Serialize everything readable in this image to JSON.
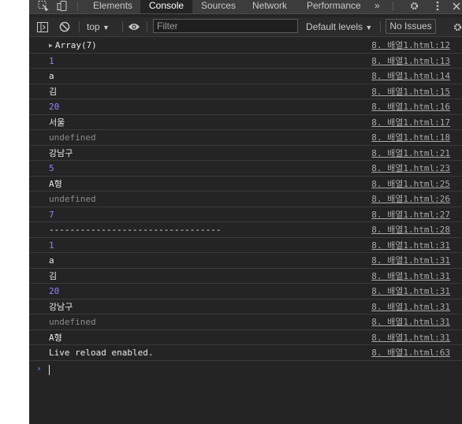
{
  "tabs": [
    {
      "label": "Elements",
      "active": false
    },
    {
      "label": "Console",
      "active": true
    },
    {
      "label": "Sources",
      "active": false
    },
    {
      "label": "Network",
      "active": false
    },
    {
      "label": "Performance",
      "active": false
    }
  ],
  "tabs_overflow": "»",
  "toolbar": {
    "context": "top",
    "filter_placeholder": "Filter",
    "levels": "Default levels",
    "issues": "No Issues"
  },
  "messages": [
    {
      "text": "Array(7)",
      "type": "obj",
      "source": "8. 배열1.html:12",
      "expandable": true
    },
    {
      "text": "1",
      "type": "num",
      "source": "8. 배열1.html:13"
    },
    {
      "text": "a",
      "type": "str",
      "source": "8. 배열1.html:14"
    },
    {
      "text": "김",
      "type": "str",
      "source": "8. 배열1.html:15"
    },
    {
      "text": "20",
      "type": "num",
      "source": "8. 배열1.html:16"
    },
    {
      "text": "서울",
      "type": "str",
      "source": "8. 배열1.html:17"
    },
    {
      "text": "undefined",
      "type": "undef",
      "source": "8. 배열1.html:18"
    },
    {
      "text": "강남구",
      "type": "str",
      "source": "8. 배열1.html:21"
    },
    {
      "text": "5",
      "type": "num",
      "source": "8. 배열1.html:23"
    },
    {
      "text": "A형",
      "type": "str",
      "source": "8. 배열1.html:25"
    },
    {
      "text": "undefined",
      "type": "undef",
      "source": "8. 배열1.html:26"
    },
    {
      "text": "7",
      "type": "num",
      "source": "8. 배열1.html:27"
    },
    {
      "text": "---------------------------------",
      "type": "str",
      "source": "8. 배열1.html:28"
    },
    {
      "text": "1",
      "type": "num",
      "source": "8. 배열1.html:31"
    },
    {
      "text": "a",
      "type": "str",
      "source": "8. 배열1.html:31"
    },
    {
      "text": "김",
      "type": "str",
      "source": "8. 배열1.html:31"
    },
    {
      "text": "20",
      "type": "num",
      "source": "8. 배열1.html:31"
    },
    {
      "text": "강남구",
      "type": "str",
      "source": "8. 배열1.html:31"
    },
    {
      "text": "undefined",
      "type": "undef",
      "source": "8. 배열1.html:31"
    },
    {
      "text": "A형",
      "type": "str",
      "source": "8. 배열1.html:31"
    },
    {
      "text": "Live reload enabled.",
      "type": "str",
      "source": "8. 배열1.html:63"
    }
  ],
  "prompt_symbol": "›",
  "colors": {
    "panel_bg": "#242424",
    "number": "#9980ff",
    "string": "#e8e8e8",
    "undefined": "#8a8a8a",
    "link": "#a8a8a8",
    "prompt": "#4aa3ff"
  }
}
